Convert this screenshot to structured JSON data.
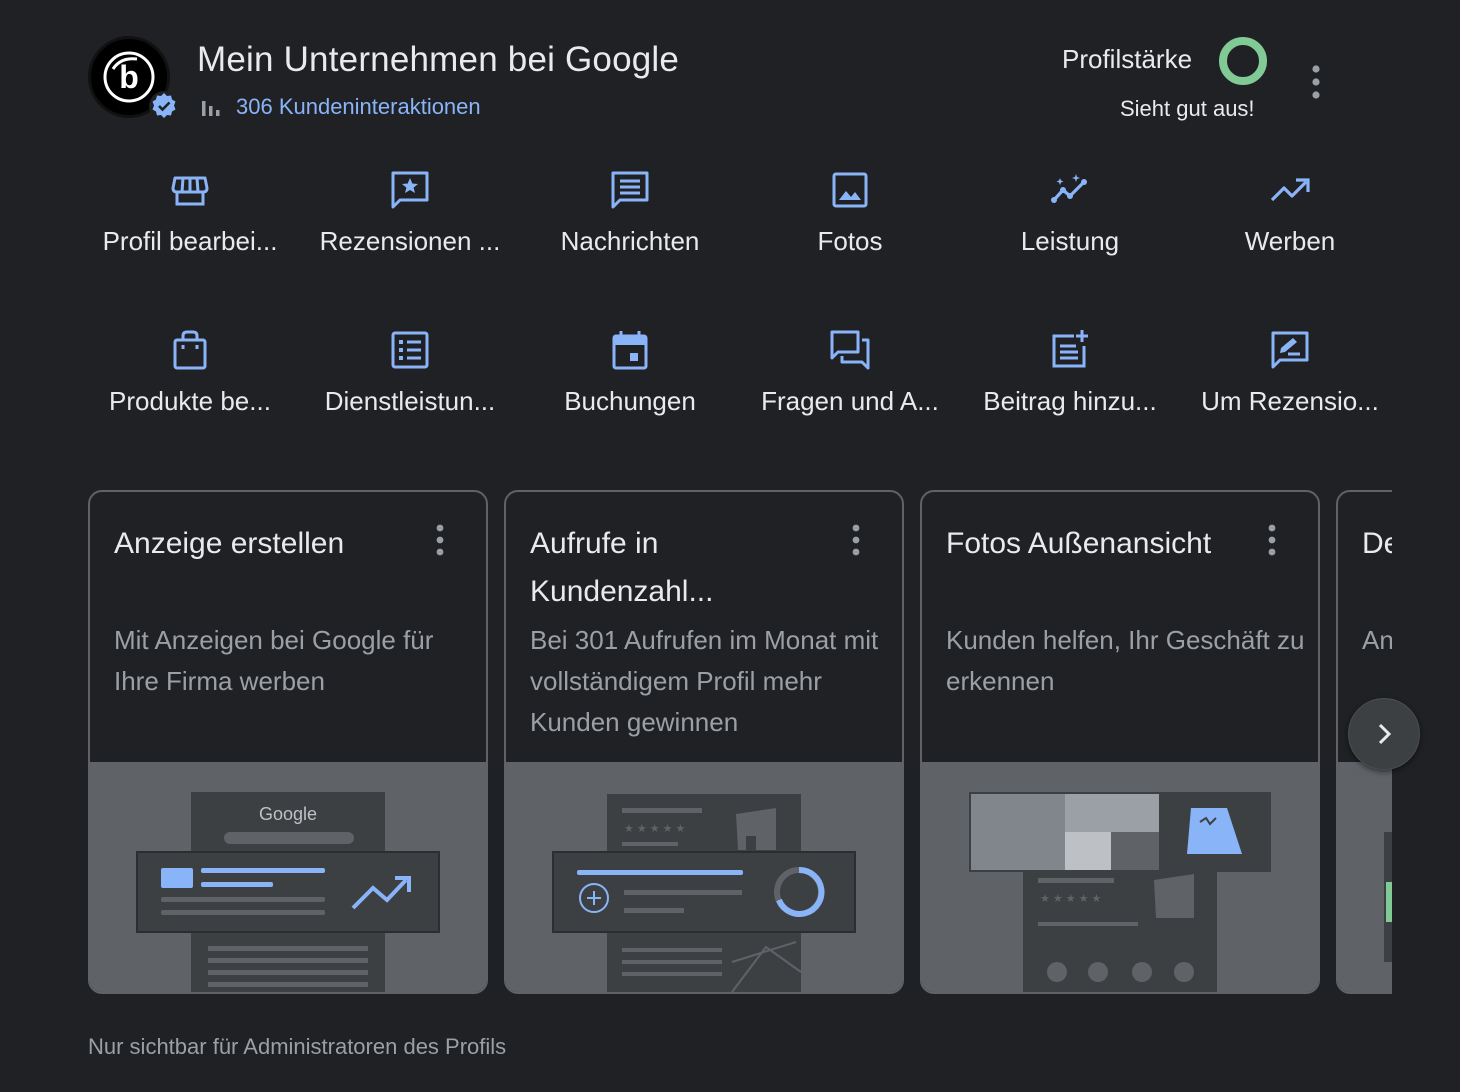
{
  "header": {
    "business_name": "Mein Unternehmen bei Google",
    "interactions": "306 Kundeninteraktionen",
    "strength_label": "Profilstärke",
    "strength_status": "Sieht gut aus!",
    "strength_color": "#81c995",
    "verified_color": "#8ab4f8"
  },
  "actions": [
    {
      "label": "Profil bearbei...",
      "icon": "store-icon"
    },
    {
      "label": "Rezensionen ...",
      "icon": "review-star-icon"
    },
    {
      "label": "Nachrichten",
      "icon": "message-icon"
    },
    {
      "label": "Fotos",
      "icon": "photo-icon"
    },
    {
      "label": "Leistung",
      "icon": "insights-icon"
    },
    {
      "label": "Werben",
      "icon": "trending-up-icon"
    },
    {
      "label": "Produkte be...",
      "icon": "shopping-bag-icon"
    },
    {
      "label": "Dienstleistun...",
      "icon": "list-icon"
    },
    {
      "label": "Buchungen",
      "icon": "calendar-icon"
    },
    {
      "label": "Fragen und A...",
      "icon": "forum-icon"
    },
    {
      "label": "Beitrag hinzu...",
      "icon": "post-add-icon"
    },
    {
      "label": "Um Rezensio...",
      "icon": "rate-review-icon"
    }
  ],
  "cards": [
    {
      "title": "Anzeige erstellen",
      "desc": "Mit Anzeigen bei Google für Ihre Firma werben",
      "illus_label": "Google"
    },
    {
      "title": "Aufrufe in Kundenzahl...",
      "desc": "Bei 301 Aufrufen im Monat mit vollständigem Profil mehr Kunden gewinnen"
    },
    {
      "title": "Fotos Außenansicht",
      "desc": "Kunden helfen, Ihr Geschäft zu erkennen"
    },
    {
      "title": "De Ka",
      "desc": "An Ur"
    }
  ],
  "footer": {
    "note": "Nur sichtbar für Administratoren des Profils"
  },
  "colors": {
    "background": "#202124",
    "accent": "#8ab4f8",
    "text": "#e8eaed",
    "muted": "#9aa0a6"
  }
}
